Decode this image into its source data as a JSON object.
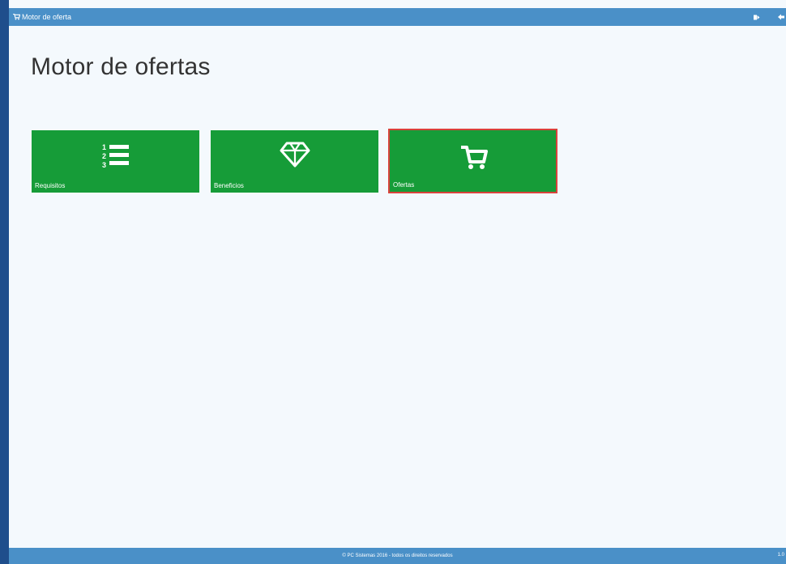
{
  "window": {
    "title": "Motor de oferta",
    "icons": {
      "app": "cart-icon",
      "exit": "exit-icon",
      "back": "back-arrow-icon"
    }
  },
  "page": {
    "heading": "Motor de ofertas"
  },
  "tiles": [
    {
      "label": "Requisitos",
      "icon": "numbered-list-icon",
      "selected": false
    },
    {
      "label": "Beneficios",
      "icon": "diamond-icon",
      "selected": false
    },
    {
      "label": "Ofertas",
      "icon": "cart-icon",
      "selected": true
    }
  ],
  "footer": {
    "copyright": "© PC Sistemas 2016 - todos os direitos reservados",
    "version": "1.0"
  },
  "colors": {
    "titlebar": "#4a90c8",
    "tile_green": "#169c38",
    "selected_border": "#d9423b",
    "frame": "#1f4e8c",
    "background": "#f4f9fd"
  }
}
